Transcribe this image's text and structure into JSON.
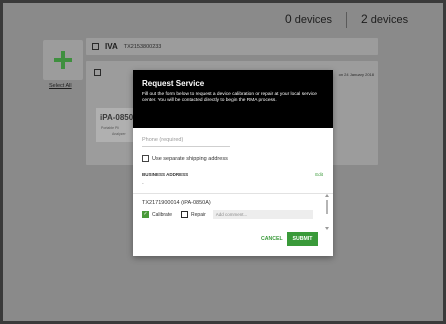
{
  "header": {
    "device_count_1": "0",
    "device_count_2": "2",
    "devices_label": "devices"
  },
  "sidebar": {
    "select_all": "Select All"
  },
  "cards": [
    {
      "name": "IVA",
      "serial": "TX2153800233"
    },
    {
      "date": "on 24 January 2018",
      "model": "iPA-0850A",
      "line1": "Portable Pli",
      "line2": "Analyzer"
    }
  ],
  "dialog": {
    "title": "Request Service",
    "description": "Fill out the form below to request a device calibration or repair at your local service center. You will be contacted directly to begin the RMA process.",
    "phone_placeholder": "Phone (required)",
    "separate_shipping": "Use separate shipping address",
    "business_address": "BUSINESS ADDRESS",
    "edit": "Edit",
    "address_value": "-",
    "device": "TX2171900014 (iPA-0850A)",
    "calibrate": "Calibrate",
    "repair": "Repair",
    "comment_placeholder": "Add comment...",
    "cancel": "CANCEL",
    "submit": "SUBMIT"
  },
  "colors": {
    "accent": "#3a9a3a",
    "overlay": "#8a8a8a",
    "dialog_header": "#000000"
  },
  "icons": {
    "add": "plus-icon",
    "calibrate_check": "check-icon"
  }
}
